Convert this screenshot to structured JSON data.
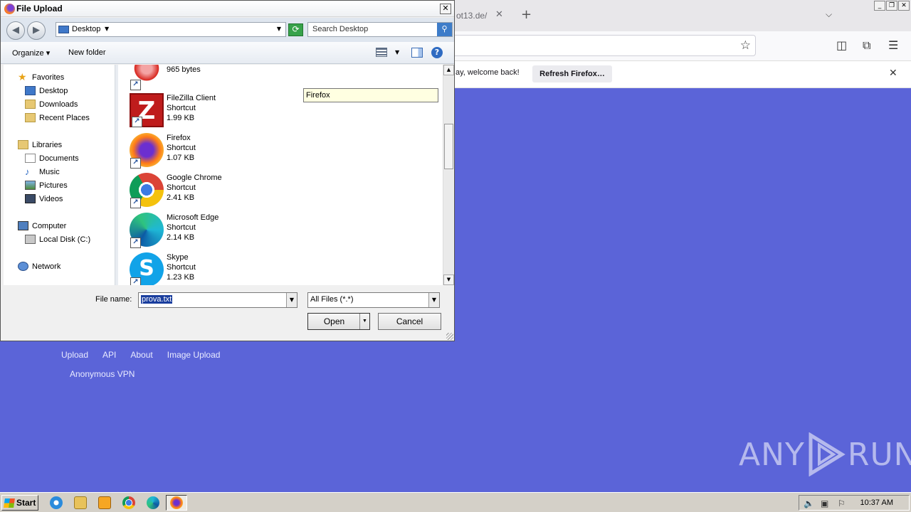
{
  "browser": {
    "tab_url_fragment": "ot13.de/",
    "notice_text": "ay, welcome back!",
    "refresh_label": "Refresh Firefox…"
  },
  "site": {
    "nav": [
      "Upload",
      "API",
      "About",
      "Image Upload"
    ],
    "nav2": "Anonymous VPN"
  },
  "watermark": {
    "left": "ANY",
    "right": "RUN"
  },
  "dialog": {
    "title": "File Upload",
    "path": "Desktop",
    "search_placeholder": "Search Desktop",
    "toolbar": {
      "organize": "Organize",
      "new_folder": "New folder"
    },
    "nav_pane": {
      "favorites": "Favorites",
      "desktop": "Desktop",
      "downloads": "Downloads",
      "recent": "Recent Places",
      "libraries": "Libraries",
      "documents": "Documents",
      "music": "Music",
      "pictures": "Pictures",
      "videos": "Videos",
      "computer": "Computer",
      "local_disk": "Local Disk (C:)",
      "network": "Network"
    },
    "files": [
      {
        "name": "",
        "type": "Shortcut",
        "size": "965 bytes",
        "icon": "acrobat-icon"
      },
      {
        "name": "FileZilla Client",
        "type": "Shortcut",
        "size": "1.99 KB",
        "icon": "filezilla-icon"
      },
      {
        "name": "Firefox",
        "type": "Shortcut",
        "size": "1.07 KB",
        "icon": "firefox-icon"
      },
      {
        "name": "Google Chrome",
        "type": "Shortcut",
        "size": "2.41 KB",
        "icon": "chrome-icon"
      },
      {
        "name": "Microsoft Edge",
        "type": "Shortcut",
        "size": "2.14 KB",
        "icon": "edge-icon"
      },
      {
        "name": "Skype",
        "type": "Shortcut",
        "size": "1.23 KB",
        "icon": "skype-icon"
      }
    ],
    "tooltip": "Firefox",
    "file_name_label": "File name:",
    "file_name_value": "prova.txt",
    "file_type_value": "All Files (*.*)",
    "open_label": "Open",
    "cancel_label": "Cancel"
  },
  "taskbar": {
    "start_label": "Start",
    "clock": "10:37 AM"
  }
}
